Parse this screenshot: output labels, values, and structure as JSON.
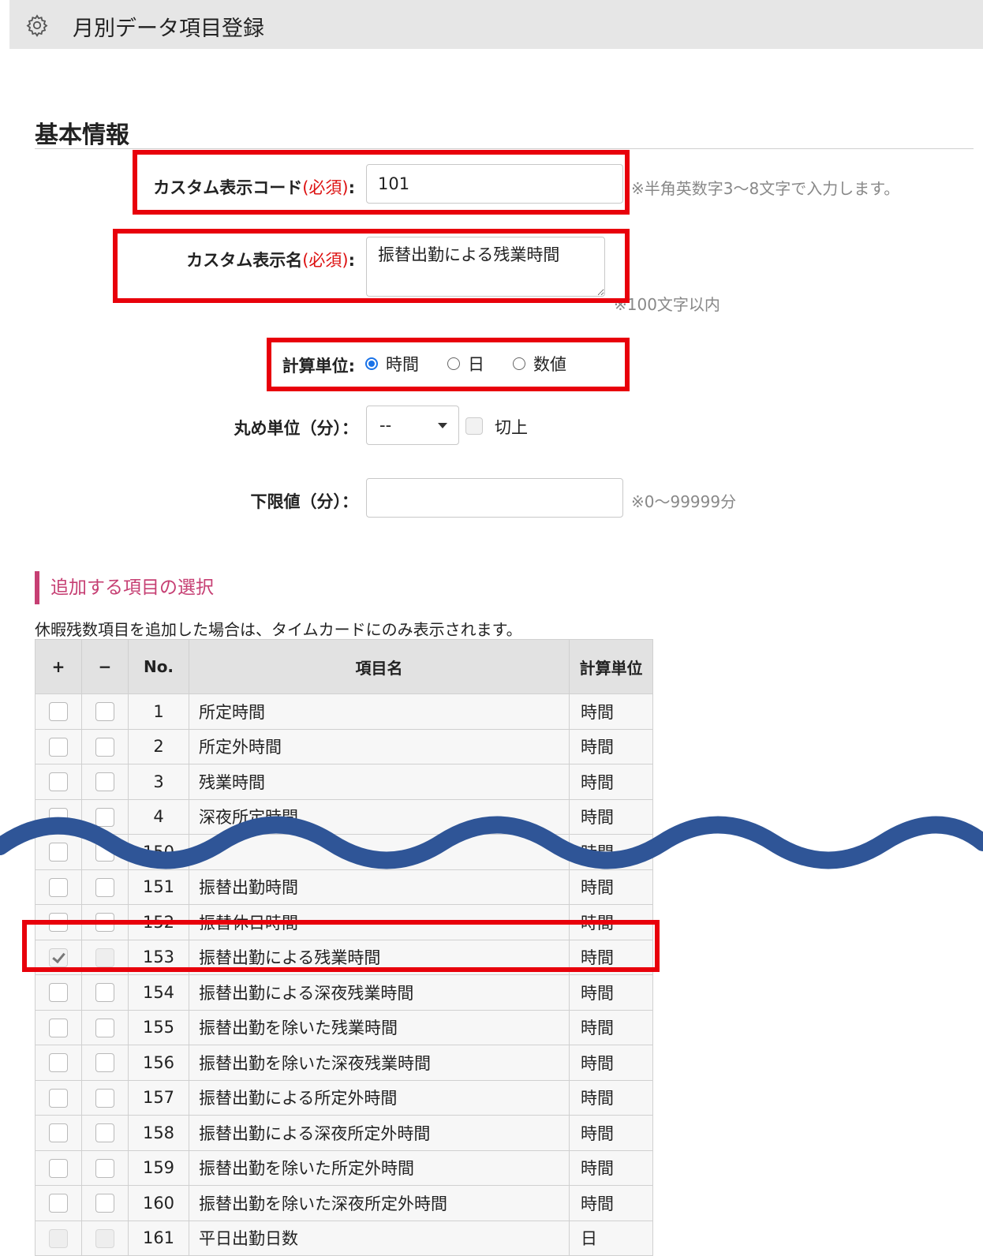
{
  "header": {
    "title": "月別データ項目登録",
    "icon": "gear-icon"
  },
  "basic_info": {
    "title": "基本情報",
    "code": {
      "label": "カスタム表示コード",
      "required": "(必須)",
      "colon": ":",
      "value": "101",
      "note": "※半角英数字3～8文字で入力します。"
    },
    "name": {
      "label": "カスタム表示名",
      "required": "(必須)",
      "colon": ":",
      "value": "振替出勤による残業時間",
      "note": "※100文字以内"
    },
    "calc_unit": {
      "label": "計算単位:",
      "options": [
        "時間",
        "日",
        "数値"
      ],
      "selected": "時間"
    },
    "rounding": {
      "label": "丸め単位（分）：",
      "select_value": "--",
      "checkbox_label": "切上",
      "checked": false
    },
    "lower_limit": {
      "label": "下限値（分）：",
      "value": "",
      "note": "※0～99999分"
    }
  },
  "selection": {
    "title": "追加する項目の選択",
    "description": "休暇残数項目を追加した場合は、タイムカードにのみ表示されます。",
    "columns": [
      "+",
      "−",
      "No.",
      "項目名",
      "計算単位"
    ],
    "rows_top": [
      {
        "no": "1",
        "name": "所定時間",
        "unit": "時間"
      },
      {
        "no": "2",
        "name": "所定外時間",
        "unit": "時間"
      },
      {
        "no": "3",
        "name": "残業時間",
        "unit": "時間"
      },
      {
        "no": "4",
        "name": "深夜所定時間",
        "unit": "時間"
      }
    ],
    "rows_bottom": [
      {
        "no": "150",
        "name": "",
        "unit": "時間"
      },
      {
        "no": "151",
        "name": "振替出勤時間",
        "unit": "時間"
      },
      {
        "no": "152",
        "name": "振替休日時間",
        "unit": "時間"
      },
      {
        "no": "153",
        "name": "振替出勤による残業時間",
        "unit": "時間",
        "checked": true
      },
      {
        "no": "154",
        "name": "振替出勤による深夜残業時間",
        "unit": "時間"
      },
      {
        "no": "155",
        "name": "振替出勤を除いた残業時間",
        "unit": "時間"
      },
      {
        "no": "156",
        "name": "振替出勤を除いた深夜残業時間",
        "unit": "時間"
      },
      {
        "no": "157",
        "name": "振替出勤による所定外時間",
        "unit": "時間"
      },
      {
        "no": "158",
        "name": "振替出勤による深夜所定外時間",
        "unit": "時間"
      },
      {
        "no": "159",
        "name": "振替出勤を除いた所定外時間",
        "unit": "時間"
      },
      {
        "no": "160",
        "name": "振替出勤を除いた深夜所定外時間",
        "unit": "時間"
      },
      {
        "no": "161",
        "name": "平日出勤日数",
        "unit": "日"
      }
    ]
  },
  "colors": {
    "highlight": "#e8000b",
    "wave": "#2f5597",
    "accent": "#c63f73",
    "radio": "#1a73e8",
    "required": "#dd1111"
  }
}
